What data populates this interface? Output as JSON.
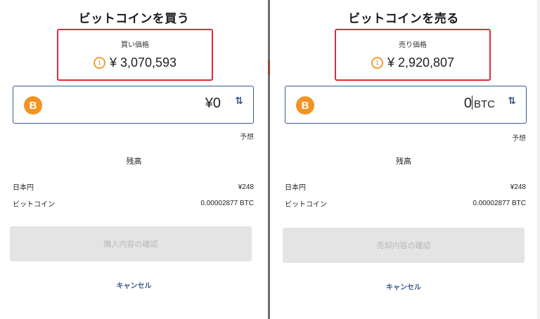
{
  "buy": {
    "title": "ビットコインを買う",
    "price_label": "買い価格",
    "price": "¥ 3,070,593",
    "timer_glyph": "1",
    "amount": "¥0",
    "amount_unit": "",
    "estimate": "予想",
    "balance_title": "残高",
    "jpy_label": "日本円",
    "jpy_value": "¥248",
    "btc_label": "ビットコイン",
    "btc_value": "0.00002877 BTC",
    "confirm_label": "購入内容の確認",
    "cancel_label": "キャンセル"
  },
  "sell": {
    "title": "ビットコインを売る",
    "price_label": "売り価格",
    "price": "¥ 2,920,807",
    "timer_glyph": "1",
    "amount": "0",
    "amount_unit": "BTC",
    "estimate": "予想",
    "balance_title": "残高",
    "jpy_label": "日本円",
    "jpy_value": "¥248",
    "btc_label": "ビットコイン",
    "btc_value": "0.00002877 BTC",
    "confirm_label": "売却内容の確認",
    "cancel_label": "キャンセル"
  },
  "icons": {
    "coin": "bitcoin-icon",
    "swap": "swap-icon",
    "timer": "timer-icon",
    "coin_glyph": "B",
    "swap_glyph": "⇅"
  },
  "colors": {
    "highlight_border": "#e02b3a",
    "input_border": "#3c5a8c",
    "bitcoin_orange": "#f29322",
    "timer_orange": "#f0a030",
    "disabled_button": "#e4e4e4"
  }
}
